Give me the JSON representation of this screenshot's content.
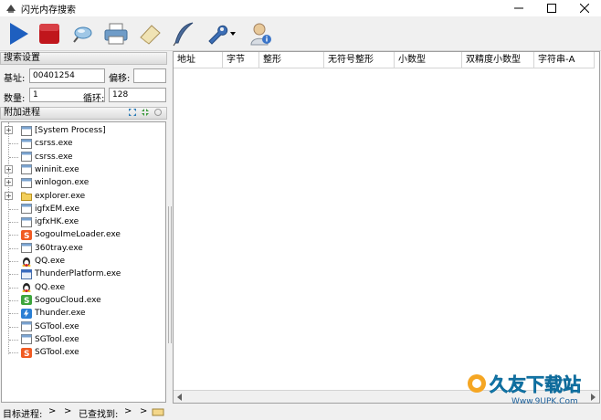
{
  "window": {
    "title": "闪光内存搜索"
  },
  "search_settings": {
    "header": "搜索设置",
    "base_label": "基址:",
    "base_value": "00401254",
    "offset_label": "偏移:",
    "offset_value": "",
    "count_label": "数量:",
    "count_value": "1",
    "loop_label": "循环:",
    "loop_value": "128"
  },
  "attach": {
    "header": "附加进程",
    "processes": [
      {
        "name": "[System Process]",
        "icon": "window-icon",
        "expandable": true
      },
      {
        "name": "csrss.exe",
        "icon": "window-icon",
        "expandable": false
      },
      {
        "name": "csrss.exe",
        "icon": "window-icon",
        "expandable": false
      },
      {
        "name": "wininit.exe",
        "icon": "window-icon",
        "expandable": true
      },
      {
        "name": "winlogon.exe",
        "icon": "window-icon",
        "expandable": true
      },
      {
        "name": "explorer.exe",
        "icon": "folder-icon",
        "expandable": true
      },
      {
        "name": "igfxEM.exe",
        "icon": "window-icon",
        "expandable": false
      },
      {
        "name": "igfxHK.exe",
        "icon": "window-icon",
        "expandable": false
      },
      {
        "name": "SogouImeLoader.exe",
        "icon": "sogou-icon",
        "expandable": false
      },
      {
        "name": "360tray.exe",
        "icon": "window-icon",
        "expandable": false
      },
      {
        "name": "QQ.exe",
        "icon": "qq-penguin-icon",
        "expandable": false
      },
      {
        "name": "ThunderPlatform.exe",
        "icon": "app-window-icon",
        "expandable": false
      },
      {
        "name": "QQ.exe",
        "icon": "qq-penguin-icon",
        "expandable": false
      },
      {
        "name": "SogouCloud.exe",
        "icon": "sogou-cloud-icon",
        "expandable": false
      },
      {
        "name": "Thunder.exe",
        "icon": "thunder-icon",
        "expandable": false
      },
      {
        "name": "SGTool.exe",
        "icon": "window-icon",
        "expandable": false
      },
      {
        "name": "SGTool.exe",
        "icon": "window-icon",
        "expandable": false
      },
      {
        "name": "SGTool.exe",
        "icon": "sogou-icon",
        "expandable": false
      }
    ]
  },
  "results": {
    "columns": [
      "地址",
      "字节",
      "整形",
      "无符号整形",
      "小数型",
      "双精度小数型",
      "字符串-A"
    ]
  },
  "status": {
    "target_label": "目标进程:",
    "target_value": ">",
    "found_label": "已查找到:",
    "found_value": ">"
  },
  "watermark": {
    "text": "久友下载站",
    "url": "Www.9UPK.Com"
  },
  "colors": {
    "accent": "#1e5fbf",
    "stop": "#c0161c",
    "sogou": "#f05a22",
    "cloud": "#3ca53c"
  }
}
